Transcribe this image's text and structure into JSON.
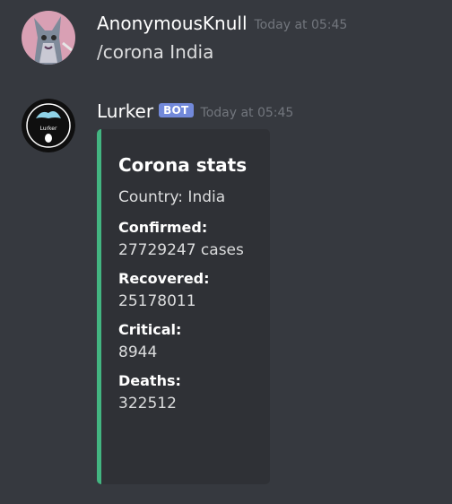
{
  "messages": [
    {
      "username": "AnonymousKnull",
      "timestamp": "Today at 05:45",
      "content": "/corona India"
    },
    {
      "username": "Lurker",
      "bot_tag": "BOT",
      "timestamp": "Today at 05:45",
      "avatar_text": "Lurker",
      "embed": {
        "accent_color": "#43b581",
        "title": "Corona stats",
        "description": "Country: India",
        "fields": [
          {
            "name": "Confirmed:",
            "value": "27729247 cases"
          },
          {
            "name": "Recovered:",
            "value": "25178011"
          },
          {
            "name": "Critical:",
            "value": "8944"
          },
          {
            "name": "Deaths:",
            "value": "322512"
          }
        ]
      }
    }
  ]
}
